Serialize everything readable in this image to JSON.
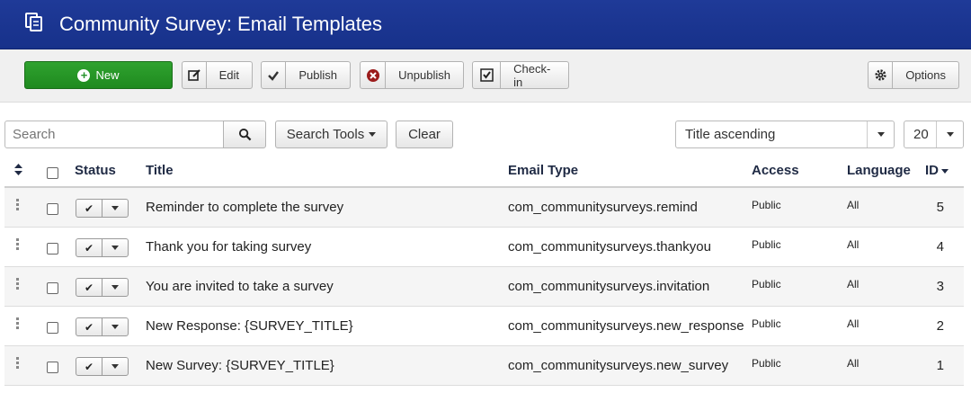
{
  "header": {
    "title": "Community Survey: Email Templates",
    "icon": "copy-icon"
  },
  "toolbar": {
    "new_label": "New",
    "edit_label": "Edit",
    "publish_label": "Publish",
    "unpublish_label": "Unpublish",
    "checkin_label": "Check-in",
    "options_label": "Options"
  },
  "filters": {
    "search_placeholder": "Search",
    "search_tools_label": "Search Tools",
    "clear_label": "Clear",
    "sort_value": "Title ascending",
    "limit_value": "20"
  },
  "table": {
    "columns": {
      "status": "Status",
      "title": "Title",
      "email_type": "Email Type",
      "access": "Access",
      "language": "Language",
      "id": "ID"
    },
    "rows": [
      {
        "title": "Reminder to complete the survey",
        "email_type": "com_communitysurveys.remind",
        "access": "Public",
        "language": "All",
        "id": "5",
        "published": true
      },
      {
        "title": "Thank you for taking survey",
        "email_type": "com_communitysurveys.thankyou",
        "access": "Public",
        "language": "All",
        "id": "4",
        "published": true
      },
      {
        "title": "You are invited to take a survey",
        "email_type": "com_communitysurveys.invitation",
        "access": "Public",
        "language": "All",
        "id": "3",
        "published": true
      },
      {
        "title": "New Response: {SURVEY_TITLE}",
        "email_type": "com_communitysurveys.new_response",
        "access": "Public",
        "language": "All",
        "id": "2",
        "published": true
      },
      {
        "title": "New Survey: {SURVEY_TITLE}",
        "email_type": "com_communitysurveys.new_survey",
        "access": "Public",
        "language": "All",
        "id": "1",
        "published": true
      }
    ]
  },
  "colors": {
    "header": "#1f3a98",
    "new_button": "#2fa22f",
    "unpublish_icon": "#9b1c1c"
  }
}
